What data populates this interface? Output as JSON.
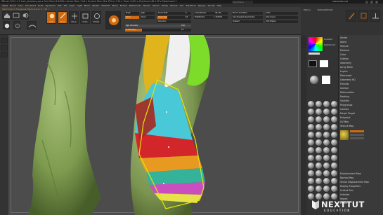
{
  "window": {
    "title": "ZBrush 2021.1.1   Liam_Anatomy.zpr  ▸ Free Mem 8.64GB ▸ Active Mem 1.04 ▸ Scratch Disk 48 ▸ ZTime 1.52 ▸ Timer 0.001 ▸ PolyCount 48.1 KP ▸ MeshCount 1",
    "quick_save": "QuickSave",
    "menus_ctl": "Menus",
    "default_script": "DefaultZScript",
    "controls": [
      "–",
      "□",
      "×"
    ]
  },
  "menubar": [
    "Alpha",
    "Brush",
    "Color",
    "Document",
    "Draw",
    "Dynamics",
    "Edit",
    "File",
    "Layer",
    "Light",
    "Macro",
    "Marker",
    "Material",
    "Movie",
    "Picture",
    "Preferences",
    "Render",
    "Stencil",
    "Stroke",
    "Texture",
    "Tool",
    "Transform",
    "Zplugin",
    "Zscript",
    "Help"
  ],
  "status": "Switching to Transpose TopoLayers  ( 6 / 45 )",
  "toolbar": {
    "buttons": [
      {
        "id": "home",
        "label": "Home Page"
      },
      {
        "id": "lightbox",
        "label": "LightBox"
      },
      {
        "id": "spotlight",
        "label": "Live Boolean"
      },
      {
        "id": "edit",
        "label": "Edit"
      },
      {
        "id": "draw",
        "label": "Draw"
      },
      {
        "id": "move",
        "label": "Move"
      },
      {
        "id": "scale",
        "label": "Scale"
      },
      {
        "id": "rotate",
        "label": "Rotate"
      }
    ],
    "mrgb": [
      "A",
      "Mrgb",
      "Rgb",
      "M"
    ],
    "zadd": "Zadd",
    "zsub": "Zsub",
    "focal_shift_label": "Focal Shift",
    "focal_shift": "0",
    "draw_size_label": "Draw Size",
    "draw_size": "64",
    "dynamic": "Dynamic",
    "rgb_intensity_label": "Rgb Intensity",
    "rgb_intensity": "100",
    "z_intensity_label": "Z Intensity",
    "z_intensity": "25",
    "active_points_label": "ActivePoints:",
    "active_points": "48,134",
    "total_points_label": "TotalPoints:",
    "total_points": "1.158 Mil",
    "mirror": "Mirror and Weld",
    "use_poseable": "Use Poseable Symmetry",
    "unweld": "Unweld",
    "sdiv": "SDiv",
    "del_lower": "Del Lower",
    "del_higher": "Del Higher",
    "live_boolean": "Live Boolean",
    "edit_label": "Edit",
    "brush_label": "Brush",
    "tool_label": "Tool"
  },
  "right_toolbar": {
    "buttons": [
      "Menus",
      "Default2Script",
      "Crease"
    ],
    "icons": [
      "brush-icon",
      "persp-icon",
      "floor-icon"
    ]
  },
  "tray_menu": [
    "Stroke",
    "Alpha",
    "Texture",
    "Material",
    "Color",
    "Subtool",
    "Geometry",
    "Array Mesh",
    "Layers",
    "Fibermesh",
    "Geometry HD",
    "Preview",
    "Surface",
    "Deformation",
    "Masking",
    "Visibility",
    "Polygroups",
    "Contact",
    "Morph Target",
    "Polypaint",
    "UV Map",
    "Texture Map",
    "Displacement Map",
    "Normal Map",
    "Vector Displacement Map",
    "Display Properties",
    "Unified Skin",
    "Initialize",
    "Import",
    "Export"
  ],
  "tray_labels": {
    "gradient": "Gradient",
    "switch_color": "SwitchColor",
    "alternate": "Alternate",
    "main_color": "Main Color",
    "secondary": "Secondary"
  },
  "watermark": {
    "brand": "NEXTTUT",
    "sub": "EDUCATION"
  },
  "colors": {
    "accent": "#d06a10",
    "viewport": "#4c4c4c",
    "mesh_left": "#8faa5c",
    "mask_yellow": "#e6e600"
  }
}
